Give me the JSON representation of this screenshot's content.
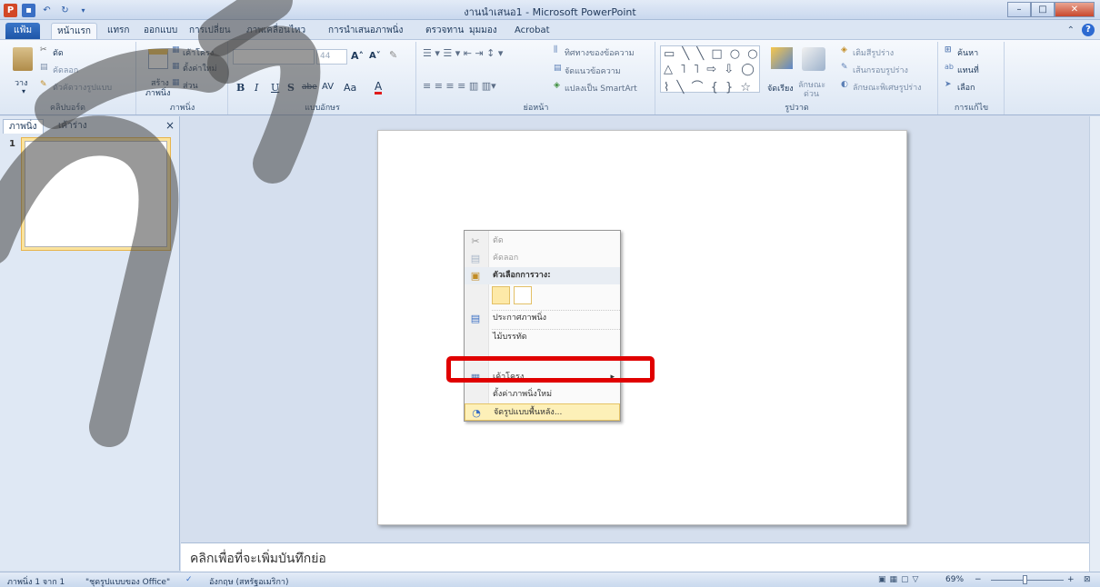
{
  "window": {
    "title": "งานนำเสนอ1 - Microsoft PowerPoint",
    "qat_icons": [
      "powerpoint-logo-icon",
      "save-icon",
      "undo-icon",
      "redo-icon"
    ]
  },
  "tabs": [
    {
      "label": "แฟ้ม",
      "id": "file"
    },
    {
      "label": "หน้าแรก",
      "id": "home",
      "active": true
    },
    {
      "label": "แทรก",
      "id": "insert"
    },
    {
      "label": "ออกแบบ",
      "id": "design"
    },
    {
      "label": "การเปลี่ยน",
      "id": "transitions"
    },
    {
      "label": "ภาพเคลื่อนไหว",
      "id": "animations"
    },
    {
      "label": "การนำเสนอภาพนิ่ง",
      "id": "slideshow"
    },
    {
      "label": "ตรวจทาน",
      "id": "review"
    },
    {
      "label": "มุมมอง",
      "id": "view"
    },
    {
      "label": "Acrobat",
      "id": "acrobat"
    }
  ],
  "ribbon": {
    "clipboard": {
      "group_label": "คลิปบอร์ด",
      "paste": "วาง",
      "cut": "ตัด",
      "copy": "คัดลอก",
      "format_painter": "ตัวคัดวางรูปแบบ"
    },
    "slides": {
      "group_label": "ภาพนิ่ง",
      "new_slide": "สร้าง",
      "new_slide2": "ภาพนิ่ง",
      "layout": "เค้าโครง",
      "reset": "ตั้งค่าใหม่",
      "section": "ส่วน"
    },
    "font": {
      "group_label": "แบบอักษร",
      "size": "44",
      "bold": "B",
      "italic": "I",
      "underline": "U",
      "shadow": "S",
      "strike": "abe",
      "spacing": "AV",
      "case": "Aa",
      "color": "A"
    },
    "paragraph": {
      "group_label": "ย่อหน้า",
      "text_direction": "ทิศทางของข้อความ",
      "align_text": "จัดแนวข้อความ",
      "smartart": "แปลงเป็น SmartArt"
    },
    "drawing": {
      "group_label": "รูปวาด",
      "arrange": "จัดเรียง",
      "quick_styles": "ลักษณะ",
      "quick_styles2": "ด่วน",
      "shape_fill": "เติมสีรูปร่าง",
      "shape_outline": "เส้นกรอบรูปร่าง",
      "shape_effects": "ลักษณะพิเศษรูปร่าง"
    },
    "editing": {
      "group_label": "การแก้ไข",
      "find": "ค้นหา",
      "replace": "แทนที่",
      "select": "เลือก"
    }
  },
  "left_pane": {
    "tab_slides": "ภาพนิ่ง",
    "tab_outline": "เค้าร่าง",
    "close": "×",
    "slide_number": "1"
  },
  "context_menu": {
    "items": [
      {
        "label": "ตัด",
        "icon": "scissors-icon",
        "disabled": true
      },
      {
        "label": "คัดลอก",
        "icon": "copy-icon",
        "disabled": true
      },
      {
        "label": "ตัวเลือกการวาง:",
        "icon": "paste-icon",
        "header": true
      },
      {
        "label": "ประกาศภาพนิ่ง",
        "icon": "publish-slides-icon"
      },
      {
        "label": "ไม้บรรทัด",
        "icon": ""
      },
      {
        "label": "เค้าโครง",
        "icon": "layout-icon",
        "submenu": true
      },
      {
        "label": "ตั้งค่าภาพนิ่งใหม่",
        "icon": ""
      },
      {
        "label": "จัดรูปแบบพื้นหลัง...",
        "icon": "format-background-icon",
        "highlighted": true
      }
    ],
    "submenu_arrow": "▸"
  },
  "notes": {
    "placeholder": "คลิกเพื่อที่จะเพิ่มบันทึกย่อ"
  },
  "status_bar": {
    "slide_info": "ภาพนิ่ง 1 จาก 1",
    "theme": "\"ชุดรูปแบบของ Office\"",
    "language": "อังกฤษ (สหรัฐอเมริกา)",
    "zoom": "69%",
    "zoom_minus": "−",
    "zoom_plus": "+"
  }
}
